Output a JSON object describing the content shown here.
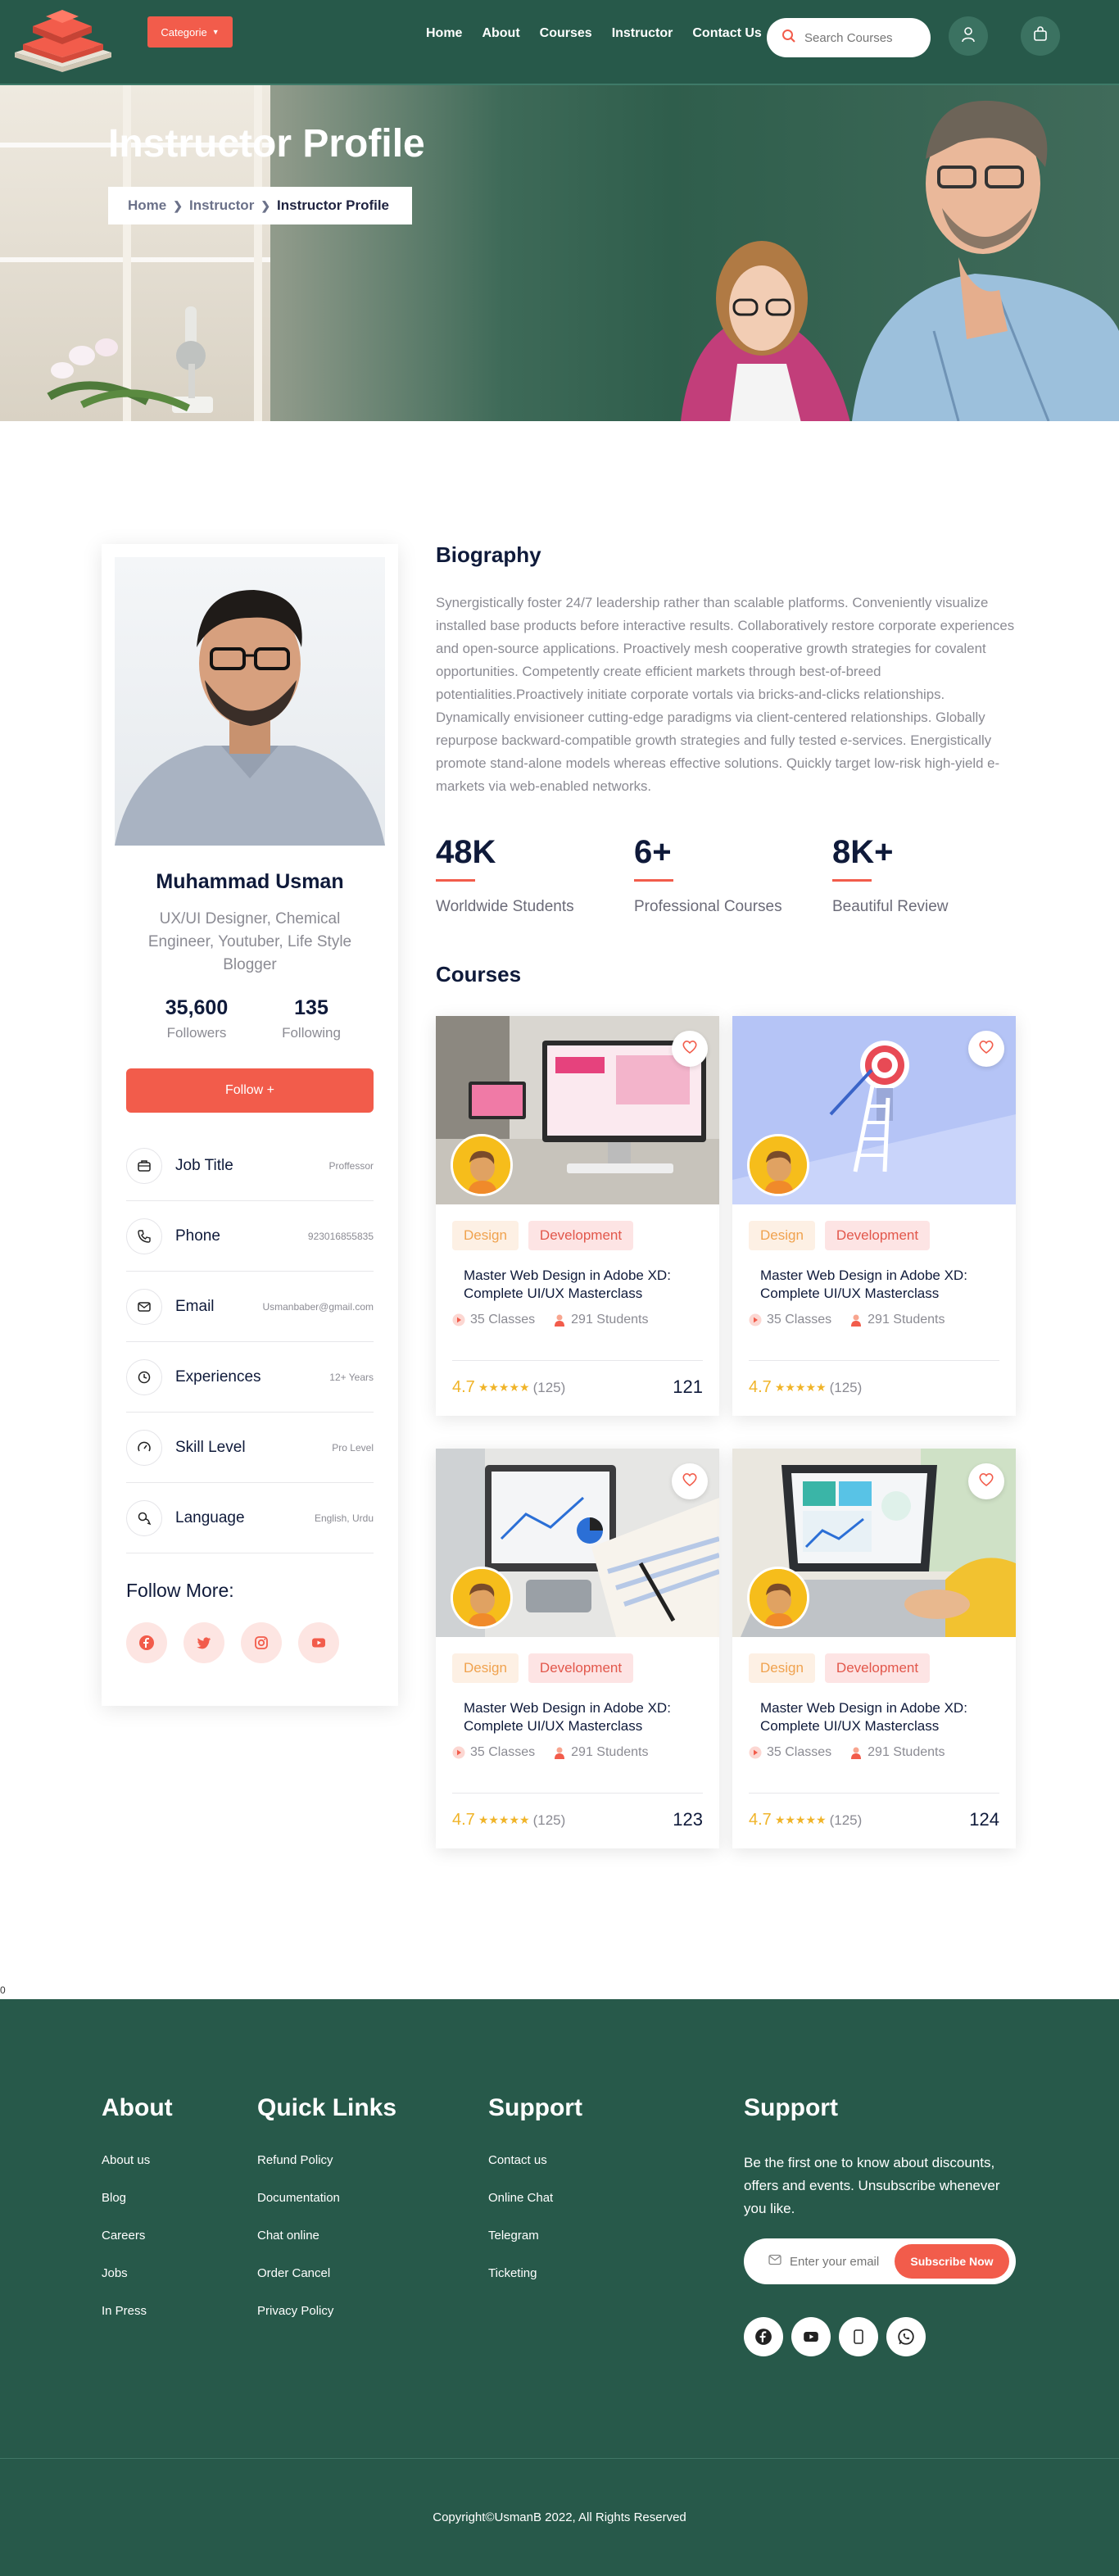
{
  "header": {
    "category_label": "Categorie",
    "nav": [
      "Home",
      "About",
      "Courses",
      "Instructor",
      "Contact Us"
    ],
    "search_placeholder": "Search Courses"
  },
  "hero": {
    "title": "Instructor Profile",
    "breadcrumb": [
      "Home",
      "Instructor",
      "Instructor Profile"
    ]
  },
  "profile": {
    "name": "Muhammad Usman",
    "role": "UX/UI Designer, Chemical Engineer, Youtuber, Life Style Blogger",
    "followers_value": "35,600",
    "followers_label": "Followers",
    "following_value": "135",
    "following_label": "Following",
    "follow_button": "Follow +",
    "info": [
      {
        "label": "Job Title",
        "value": "Proffessor",
        "icon": "briefcase-icon"
      },
      {
        "label": "Phone",
        "value": "923016855835",
        "icon": "phone-icon"
      },
      {
        "label": "Email",
        "value": "Usmanbaber@gmail.com",
        "icon": "mail-icon"
      },
      {
        "label": "Experiences",
        "value": "12+ Years",
        "icon": "clock-icon"
      },
      {
        "label": "Skill Level",
        "value": "Pro Level",
        "icon": "gauge-icon"
      },
      {
        "label": "Language",
        "value": "English, Urdu",
        "icon": "chat-icon"
      }
    ],
    "follow_more": "Follow More:",
    "socials": [
      "facebook-icon",
      "twitter-icon",
      "instagram-icon",
      "youtube-icon"
    ]
  },
  "biography": {
    "title": "Biography",
    "text": "Synergistically foster 24/7 leadership rather than scalable platforms. Conveniently visualize installed base products before interactive results. Collaboratively restore corporate experiences and open-source applications. Proactively mesh cooperative growth strategies for covalent opportunities. Competently create efficient markets through best-of-breed potentialities.Proactively initiate corporate vortals via bricks-and-clicks relationships. Dynamically envisioneer cutting-edge paradigms via client-centered relationships. Globally repurpose backward-compatible growth strategies and fully tested e-services. Energistically promote stand-alone models whereas effective solutions. Quickly target low-risk high-yield e-markets via web-enabled networks."
  },
  "kpis": [
    {
      "value": "48K",
      "label": "Worldwide Students"
    },
    {
      "value": "6+",
      "label": "Professional Courses"
    },
    {
      "value": "8K+",
      "label": "Beautiful Review"
    }
  ],
  "courses_title": "Courses",
  "courses": [
    {
      "tag1": "Design",
      "tag2": "Development",
      "title": "Master Web Design in Adobe XD: Complete UI/UX Masterclass",
      "classes": "35 Classes",
      "students": "291 Students",
      "rating": "4.7",
      "stars": "★★★★★",
      "count": "(125)",
      "price": "121",
      "colors": {
        "accent": "#f25c4b"
      }
    },
    {
      "tag1": "Design",
      "tag2": "Development",
      "title": "Master Web Design in Adobe XD: Complete UI/UX Masterclass",
      "classes": "35 Classes",
      "students": "291 Students",
      "rating": "4.7",
      "stars": "★★★★★",
      "count": "(125)",
      "price": "",
      "colors": {
        "accent": "#f25c4b"
      }
    },
    {
      "tag1": "Design",
      "tag2": "Development",
      "title": "Master Web Design in Adobe XD: Complete UI/UX Masterclass",
      "classes": "35 Classes",
      "students": "291 Students",
      "rating": "4.7",
      "stars": "★★★★★",
      "count": "(125)",
      "price": "123",
      "colors": {
        "accent": "#f25c4b"
      }
    },
    {
      "tag1": "Design",
      "tag2": "Development",
      "title": "Master Web Design in Adobe XD: Complete UI/UX Masterclass",
      "classes": "35 Classes",
      "students": "291 Students",
      "rating": "4.7",
      "stars": "★★★★★",
      "count": "(125)",
      "price": "124",
      "colors": {
        "accent": "#f25c4b"
      }
    }
  ],
  "stray_text": "0",
  "footer": {
    "about_title": "About",
    "about_links": [
      "About us",
      "Blog",
      "Careers",
      "Jobs",
      "In Press"
    ],
    "quick_title": "Quick Links",
    "quick_links": [
      "Refund Policy",
      "Documentation",
      "Chat online",
      "Order Cancel",
      "Privacy Policy"
    ],
    "support_title": "Support",
    "support_links": [
      "Contact us",
      "Online Chat",
      "Telegram",
      "Ticketing"
    ],
    "newsletter_title": "Support",
    "newsletter_desc": "Be the first one to know about discounts, offers and events. Unsubscribe whenever you like.",
    "email_placeholder": "Enter your email",
    "subscribe_label": "Subscribe Now",
    "socials": [
      "facebook-icon",
      "youtube-icon",
      "phone-icon",
      "whatsapp-icon"
    ],
    "copyright": "Copyright©UsmanB 2022, All Rights Reserved"
  },
  "colors": {
    "brand_green": "#27594a",
    "accent": "#f25c4b",
    "star": "#f0b429"
  }
}
